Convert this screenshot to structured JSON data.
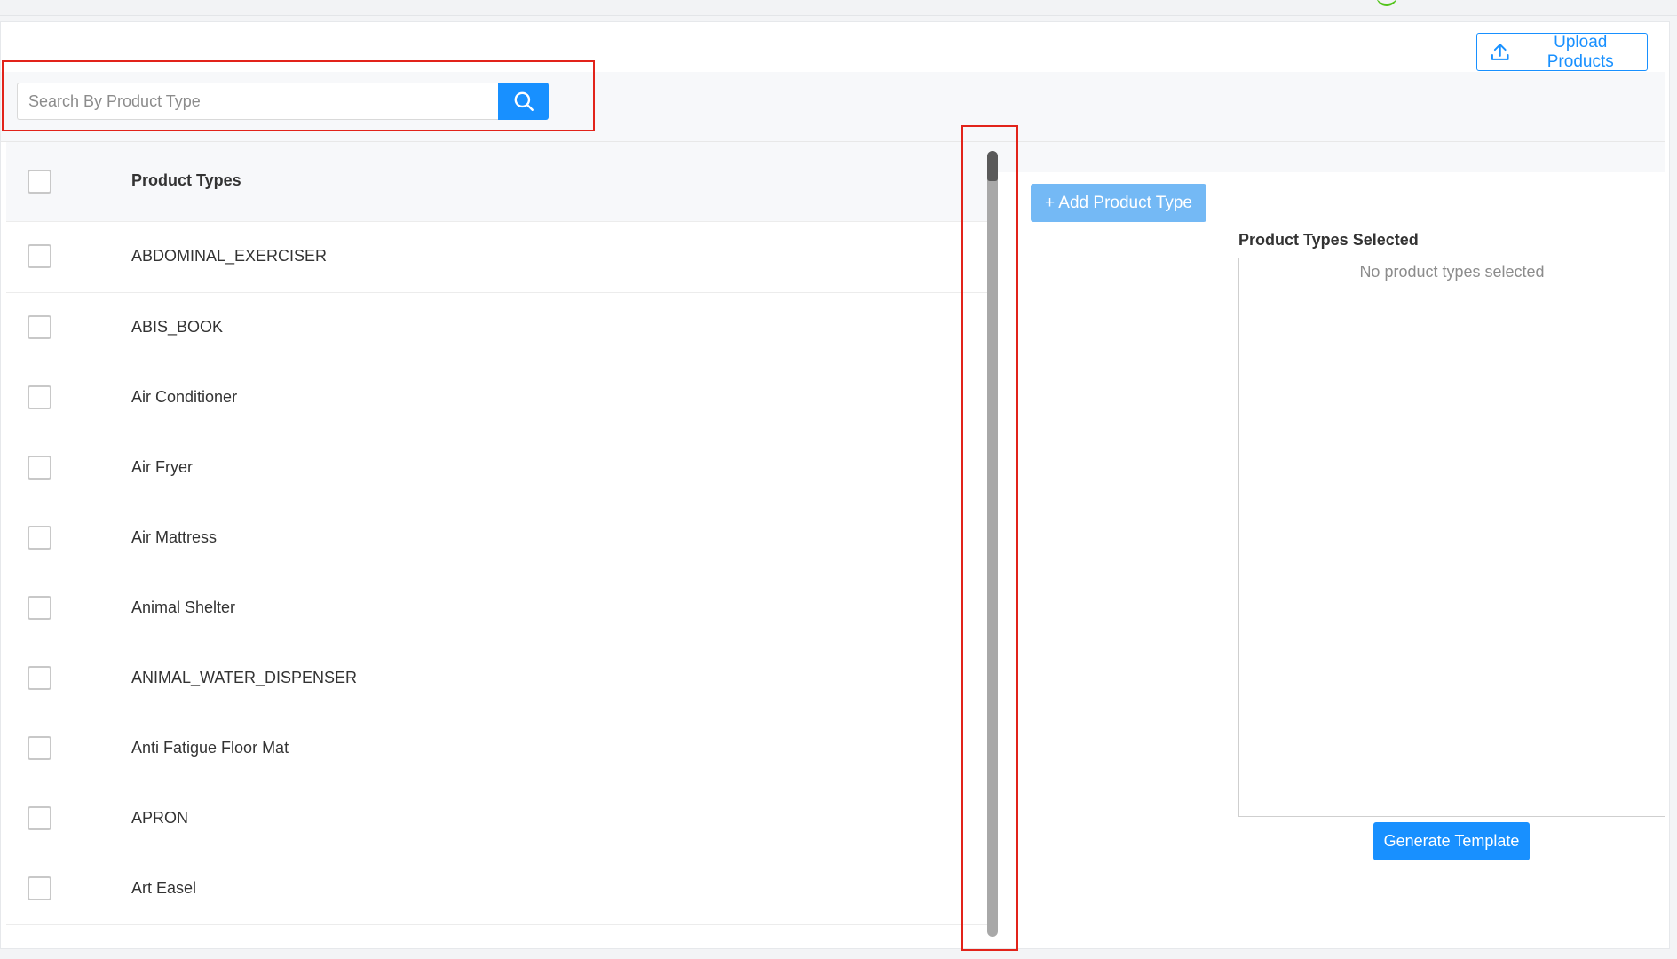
{
  "header": {
    "upload_label": "Upload Products"
  },
  "search": {
    "placeholder": "Search By Product Type",
    "value": ""
  },
  "table": {
    "header_label": "Product Types",
    "rows": [
      {
        "label": "ABDOMINAL_EXERCISER",
        "checked": false
      },
      {
        "label": "ABIS_BOOK",
        "checked": false
      },
      {
        "label": "Air Conditioner",
        "checked": false
      },
      {
        "label": "Air Fryer",
        "checked": false
      },
      {
        "label": "Air Mattress",
        "checked": false
      },
      {
        "label": "Animal Shelter",
        "checked": false
      },
      {
        "label": "ANIMAL_WATER_DISPENSER",
        "checked": false
      },
      {
        "label": "Anti Fatigue Floor Mat",
        "checked": false
      },
      {
        "label": "APRON",
        "checked": false
      },
      {
        "label": "Art Easel",
        "checked": false
      }
    ]
  },
  "actions": {
    "add_label": "+ Add Product Type",
    "generate_label": "Generate Template"
  },
  "selection": {
    "title": "Product Types Selected",
    "empty_text": "No product types selected"
  },
  "colors": {
    "primary": "#1890ff",
    "primary_disabled": "#74b9f5",
    "highlight": "#e2231a"
  },
  "icons": {
    "upload": "upload-icon",
    "search": "search-icon"
  }
}
